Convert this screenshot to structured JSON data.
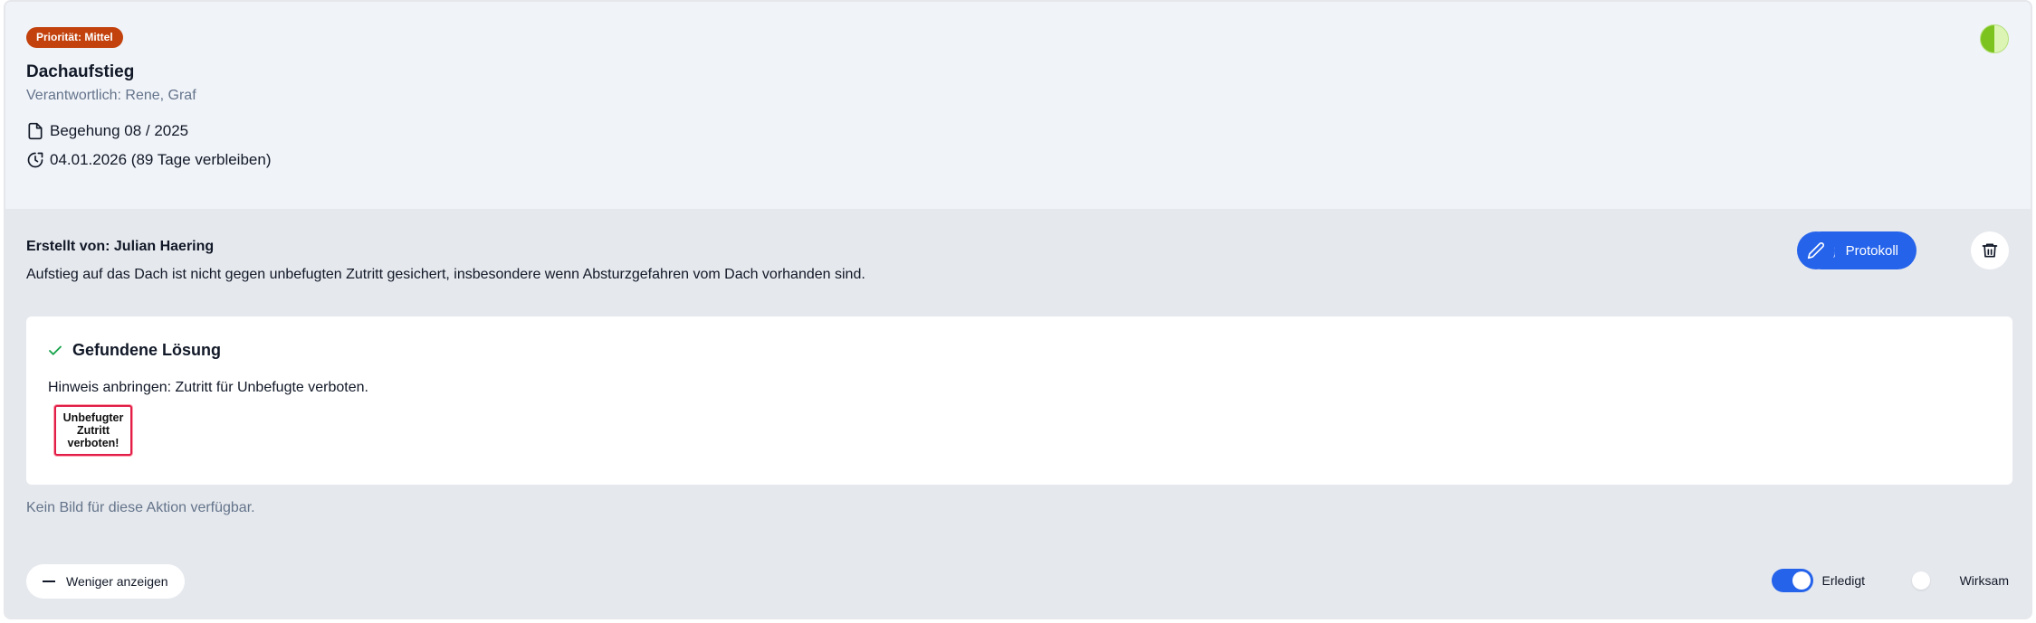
{
  "task": {
    "priority_badge": "Priorität: Mittel",
    "title": "Dachaufstieg",
    "responsible": "Verantwortlich: Rene, Graf",
    "inspection": "Begehung 08 / 2025",
    "due": "04.01.2026 (89 Tage verbleiben)"
  },
  "details": {
    "created_by": "Erstellt von: Julian Haering",
    "description": "Aufstieg auf das Dach ist nicht gegen unbefugten Zutritt gesichert, insbesondere wenn Absturzgefahren vom Dach vorhanden sind."
  },
  "actions": {
    "protokoll_label": "Protokoll"
  },
  "solution": {
    "heading": "Gefundene Lösung",
    "text": "Hinweis anbringen: Zutritt für Unbefugte verboten.",
    "sign_line1": "Unbefugter",
    "sign_line2": "Zutritt",
    "sign_line3": "verboten!"
  },
  "no_image_text": "Kein Bild für diese Aktion verfügbar.",
  "footer": {
    "less_label": "Weniger anzeigen",
    "done_label": "Erledigt",
    "done_state": true,
    "effective_label": "Wirksam",
    "effective_state": false
  },
  "colors": {
    "priority": "#c2410c",
    "accent": "#2563eb",
    "status": "#7cc31f"
  }
}
